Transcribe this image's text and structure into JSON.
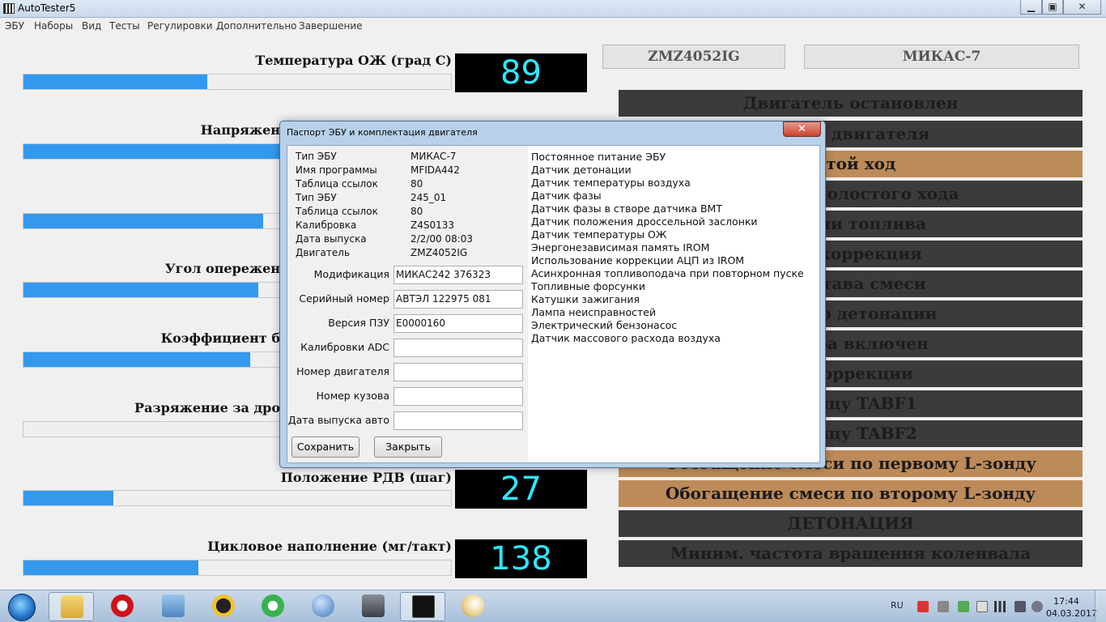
{
  "window": {
    "title": "AutoTester5"
  },
  "menu": [
    "ЭБУ",
    "Наборы",
    "Вид",
    "Тесты",
    "Регулировки",
    "Дополнительно",
    "Завершение"
  ],
  "gauges": [
    {
      "label": "Температура ОЖ (град С)",
      "value": "89",
      "fill_fraction": 0.43
    },
    {
      "label": "Напряжен",
      "value": "",
      "fill_fraction": 0.65
    },
    {
      "label": "",
      "value": "",
      "fill_fraction": 0.56
    },
    {
      "label": "Угол опережен",
      "value": "",
      "fill_fraction": 0.55
    },
    {
      "label": "Коэффициент б",
      "value": "",
      "fill_fraction": 0.53
    },
    {
      "label": "Разряжение за дро",
      "value": "",
      "fill_fraction": 0.0
    },
    {
      "label": "Положение РДВ (шаг)",
      "value": "27",
      "fill_fraction": 0.21
    },
    {
      "label": "Цикловое наполнение (мг/такт)",
      "value": "138",
      "fill_fraction": 0.41
    }
  ],
  "ecu": {
    "engine": "ZMZ4052IG",
    "controller": "МИКАС-7"
  },
  "statuses": [
    {
      "text": "Двигатель остановлен",
      "state": "off"
    },
    {
      "text": "пуска двигателя",
      "state": "off"
    },
    {
      "text": "остой ход",
      "state": "on"
    },
    {
      "text": "хода из холостого хода",
      "state": "off"
    },
    {
      "text": "подачи топлива",
      "state": "off"
    },
    {
      "text": "ная коррекция",
      "state": "off"
    },
    {
      "text": "а состава смеси",
      "state": "off"
    },
    {
      "text": "УОЗ по детонации",
      "state": "off"
    },
    {
      "text": "орбера включен",
      "state": "off"
    },
    {
      "text": "рокоррекции",
      "state": "off"
    },
    {
      "text": "аблицу TABF1",
      "state": "off"
    },
    {
      "text": "аблицу TABF2",
      "state": "off"
    },
    {
      "text": "Обогащение смеси по первому L-зонду",
      "state": "on"
    },
    {
      "text": "Обогащение смеси по второму  L-зонду",
      "state": "on"
    },
    {
      "text": "ДЕТОНАЦИЯ",
      "state": "off"
    },
    {
      "text": "Миним. частота вращения коленвала",
      "state": "off"
    }
  ],
  "dialog": {
    "title": "Паспорт ЭБУ и комплектация двигателя",
    "close_glyph": "✕",
    "info": [
      {
        "label": "Тип ЭБУ",
        "value": "МИКАС-7"
      },
      {
        "label": "Имя программы",
        "value": "MFIDA442"
      },
      {
        "label": "Таблица ссылок",
        "value": "80"
      },
      {
        "label": "Тип ЭБУ",
        "value": "245_01"
      },
      {
        "label": "Таблица ссылок",
        "value": "80"
      },
      {
        "label": "Калибровка",
        "value": "Z4S0133"
      },
      {
        "label": "Дата выпуска",
        "value": "2/2/00 08:03"
      },
      {
        "label": "Двигатель",
        "value": "ZMZ4052IG"
      }
    ],
    "fields": [
      {
        "label": "Модификация",
        "value": "МИКАС242 376323"
      },
      {
        "label": "Серийный номер",
        "value": "АВТЭЛ 122975 081"
      },
      {
        "label": "Версия ПЗУ",
        "value": "E0000160"
      },
      {
        "label": "Калибровки ADC",
        "value": ""
      },
      {
        "label": "Номер двигателя",
        "value": ""
      },
      {
        "label": "Номер кузова",
        "value": ""
      },
      {
        "label": "Дата выпуска авто",
        "value": ""
      }
    ],
    "save_label": "Сохранить",
    "close_label": "Закрыть",
    "components": [
      "Постоянное питание ЭБУ",
      "Датчик детонации",
      "Датчик температуры воздуха",
      "Датчик фазы",
      "Датчик фазы в створе датчика ВМТ",
      "Датчик положения дроссельной заслонки",
      "Датчик температуры ОЖ",
      "Энергонезависимая память IROM",
      "Использование коррекции АЦП из IROM",
      "Асинхронная топливоподача при повторном пуске",
      "Топливные форсунки",
      "Катушки зажигания",
      "Лампа неисправностей",
      "Электрический бензонасос",
      "Датчик массового расхода воздуха"
    ]
  },
  "taskbar": {
    "apps": [
      "windows-explorer",
      "opera",
      "network-folder",
      "archicad",
      "icq",
      "qbittorrent",
      "world-of-tanks",
      "autotester",
      "paint"
    ],
    "language": "RU",
    "time": "17:44",
    "date": "04.03.2017"
  },
  "colors": {
    "bar_fill": "#3399ee",
    "digit": "#2ee8ff",
    "status_off": "#3b3b3b",
    "status_on": "#bd8a59"
  }
}
